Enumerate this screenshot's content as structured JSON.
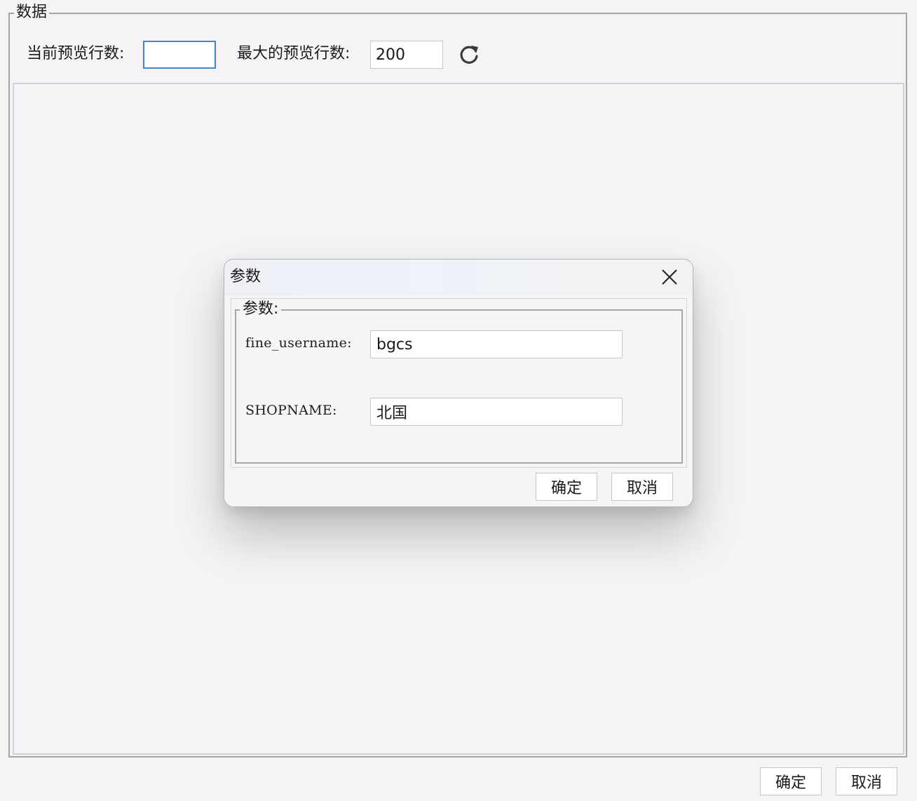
{
  "main": {
    "group_title": "数据",
    "current_rows_label": "当前预览行数:",
    "current_rows_value": "",
    "max_rows_label": "最大的预览行数:",
    "max_rows_value": "200",
    "refresh_icon": "refresh-icon"
  },
  "footer": {
    "ok_label": "确定",
    "cancel_label": "取消"
  },
  "dialog": {
    "title": "参数",
    "close_icon": "close-icon",
    "group_title": "参数:",
    "params": [
      {
        "label": "fine_username:",
        "value": "bgcs"
      },
      {
        "label": "SHOPNAME:",
        "value": "北国"
      }
    ],
    "ok_label": "确定",
    "cancel_label": "取消"
  },
  "colors": {
    "background": "#f4f4f6",
    "focus_border": "#3d84d6",
    "group_border": "#a6a6a6"
  }
}
